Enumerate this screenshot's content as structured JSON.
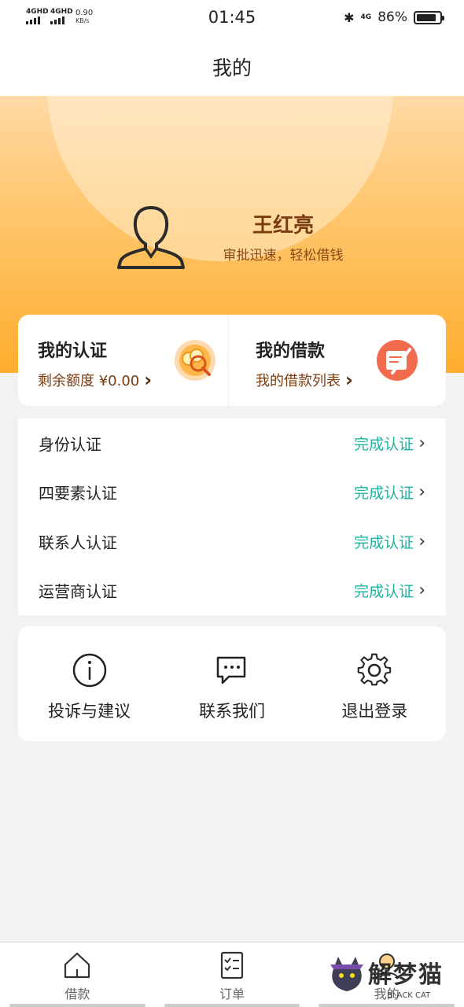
{
  "status_bar": {
    "signal_1": "4GHD",
    "signal_2": "4GHD",
    "net_speed": "0.90",
    "net_unit": "KB/s",
    "time": "01:45",
    "network": "4G",
    "battery": "86%",
    "battery_level": 0.86
  },
  "nav": {
    "title": "我的"
  },
  "profile": {
    "name": "王红亮",
    "slogan": "审批迅速，轻松借钱"
  },
  "quick_cards": [
    {
      "title": "我的认证",
      "subtitle": "剩余额度 ¥0.00",
      "icon": "coins-search-icon"
    },
    {
      "title": "我的借款",
      "subtitle": "我的借款列表",
      "icon": "document-pen-icon"
    }
  ],
  "auth_items": [
    {
      "label": "身份认证",
      "status": "完成认证"
    },
    {
      "label": "四要素认证",
      "status": "完成认证"
    },
    {
      "label": "联系人认证",
      "status": "完成认证"
    },
    {
      "label": "运营商认证",
      "status": "完成认证"
    }
  ],
  "tools": [
    {
      "label": "投诉与建议",
      "icon": "info-icon"
    },
    {
      "label": "联系我们",
      "icon": "chat-icon"
    },
    {
      "label": "退出登录",
      "icon": "gear-icon"
    }
  ],
  "tabs": [
    {
      "label": "借款",
      "icon": "home-icon"
    },
    {
      "label": "订单",
      "icon": "checklist-icon"
    },
    {
      "label": "我的",
      "icon": "user-icon"
    }
  ],
  "watermark": {
    "text": "解梦猫",
    "sub": "BLACK CAT"
  },
  "colors": {
    "accent": "#ffad2e",
    "brown": "#7a3b10",
    "teal": "#1fb3a0"
  }
}
